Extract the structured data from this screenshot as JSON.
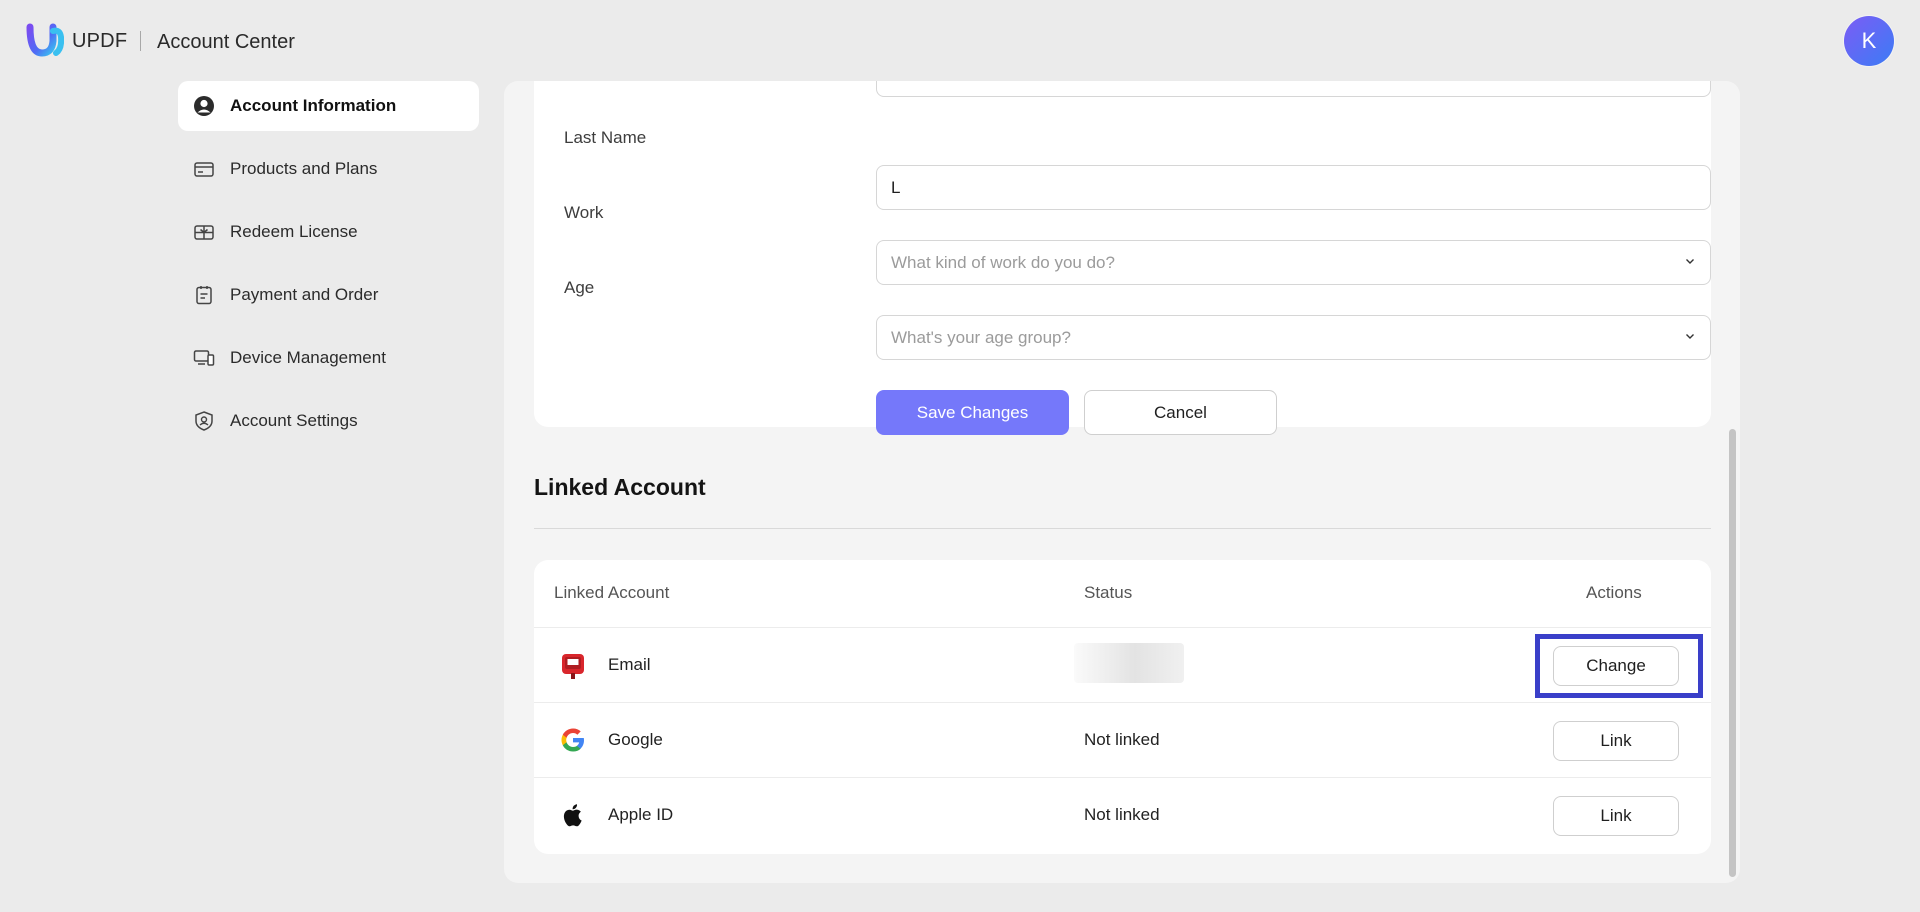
{
  "header": {
    "brand": "UPDF",
    "subtitle": "Account Center",
    "avatar_initial": "K",
    "brand_colors": {
      "purple": "#7a4cf0",
      "blue": "#3b82f6"
    }
  },
  "sidebar": {
    "items": [
      {
        "label": "Account Information",
        "icon": "user-circle-icon",
        "active": true
      },
      {
        "label": "Products and Plans",
        "icon": "card-icon"
      },
      {
        "label": "Redeem License",
        "icon": "gift-card-icon"
      },
      {
        "label": "Payment and Order",
        "icon": "clipboard-icon"
      },
      {
        "label": "Device Management",
        "icon": "devices-icon"
      },
      {
        "label": "Account Settings",
        "icon": "shield-user-icon"
      }
    ]
  },
  "form": {
    "last_name": {
      "label": "Last Name",
      "value": "L"
    },
    "work": {
      "label": "Work",
      "placeholder": "What kind of work do you do?"
    },
    "age": {
      "label": "Age",
      "placeholder": "What's your age group?"
    },
    "save_label": "Save Changes",
    "cancel_label": "Cancel",
    "accent_color": "#7578fa"
  },
  "linked": {
    "title": "Linked Account",
    "columns": {
      "account": "Linked Account",
      "status": "Status",
      "actions": "Actions"
    },
    "rows": [
      {
        "name": "Email",
        "icon": "mailbox-icon",
        "status": "",
        "action": "Change"
      },
      {
        "name": "Google",
        "icon": "google-icon",
        "status": "Not linked",
        "action": "Link"
      },
      {
        "name": "Apple ID",
        "icon": "apple-icon",
        "status": "Not linked",
        "action": "Link"
      }
    ],
    "highlight_color": "#3a3fc9"
  }
}
